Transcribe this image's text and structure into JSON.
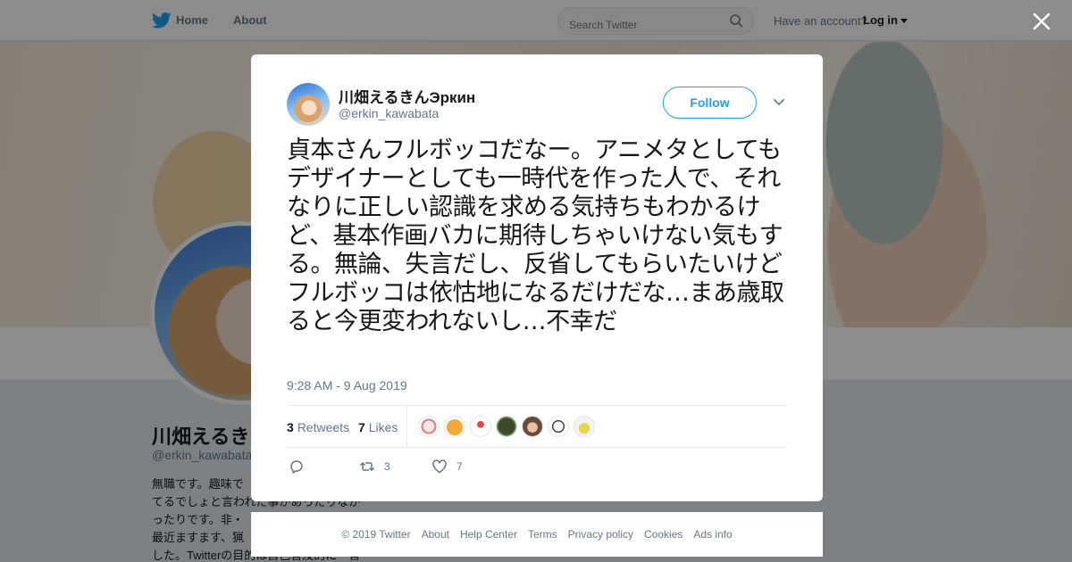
{
  "nav": {
    "home": "Home",
    "about": "About",
    "search_placeholder": "Search Twitter",
    "have_account": "Have an account?",
    "login": "Log in"
  },
  "profile": {
    "name": "川畑えるきんЭркин",
    "handle": "@erkin_kawabata",
    "bio_lines": [
      "無職です。趣味で",
      "てるでしょと言われた事があったりなが",
      "ったりです。非・",
      "最近ますます、猟",
      "した。Twitterの目的は自己言及的に一言"
    ]
  },
  "tweet": {
    "author_name": "川畑えるきんЭркин",
    "author_handle": "@erkin_kawabata",
    "follow_label": "Follow",
    "text": "貞本さんフルボッコだなー。アニメタとしてもデザイナーとしても一時代を作った人で、それなりに正しい認識を求める気持ちもわかるけど、基本作画バカに期待しちゃいけない気もする。無論、失言だし、反省してもらいたいけどフルボッコは依怙地になるだけだな…まあ歳取ると今更変われないし…不幸だ",
    "timestamp": "9:28 AM - 9 Aug 2019",
    "retweets_count": "3",
    "retweets_label": "Retweets",
    "likes_count": "7",
    "likes_label": "Likes",
    "actions": {
      "retweet_count": "3",
      "like_count": "7"
    }
  },
  "footer": {
    "copyright": "© 2019 Twitter",
    "links": [
      "About",
      "Help Center",
      "Terms",
      "Privacy policy",
      "Cookies",
      "Ads info"
    ]
  },
  "colors": {
    "accent": "#1da1f2",
    "text": "#14171a",
    "muted": "#657786",
    "overlay": "rgba(0,0,0,0.45)"
  }
}
